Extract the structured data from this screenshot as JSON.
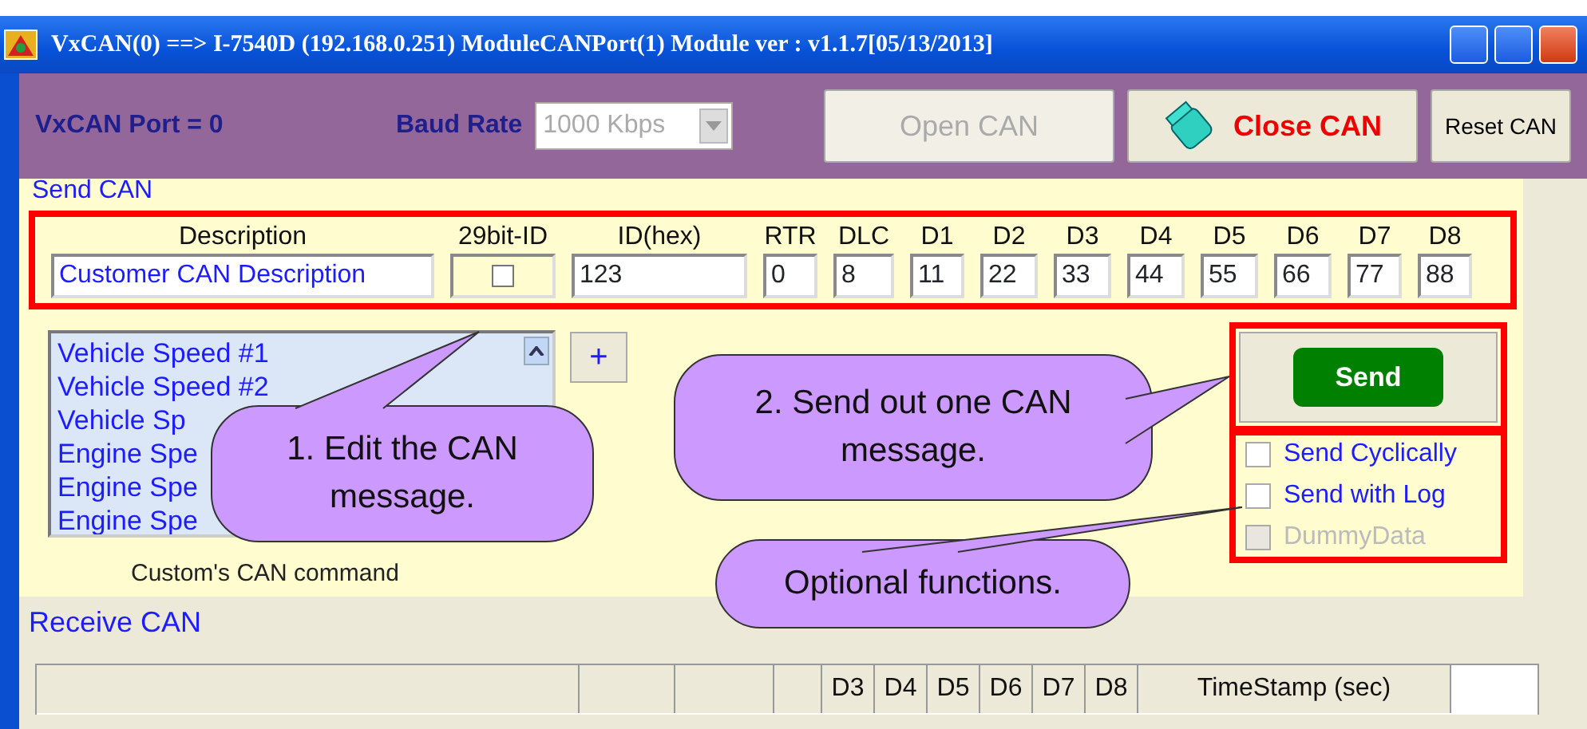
{
  "window": {
    "title": "VxCAN(0) ==> I-7540D (192.168.0.251) ModuleCANPort(1) Module ver : v1.1.7[05/13/2013]"
  },
  "toolbar": {
    "port_label": "VxCAN Port = 0",
    "baud_label": "Baud Rate",
    "baud_value": "1000 Kbps",
    "baud_disabled": true,
    "buttons": [
      {
        "label": "Open CAN",
        "kind": "plain",
        "disabled": true
      },
      {
        "label": "Close CAN",
        "kind": "icon",
        "disabled": false
      },
      {
        "label": "Reset CAN",
        "kind": "small",
        "disabled": false
      }
    ]
  },
  "send_can": {
    "title": "Send CAN",
    "fields": [
      {
        "label": "Description",
        "kind": "text",
        "value": "Customer CAN Description"
      },
      {
        "label": "29bit-ID",
        "kind": "checkbox",
        "checked": false
      },
      {
        "label": "ID(hex)",
        "kind": "text",
        "value": "123"
      },
      {
        "label": "RTR",
        "kind": "text",
        "value": "0"
      },
      {
        "label": "DLC",
        "kind": "text",
        "value": "8"
      },
      {
        "label": "D1",
        "kind": "text",
        "value": "11"
      },
      {
        "label": "D2",
        "kind": "text",
        "value": "22"
      },
      {
        "label": "D3",
        "kind": "text",
        "value": "33"
      },
      {
        "label": "D4",
        "kind": "text",
        "value": "44"
      },
      {
        "label": "D5",
        "kind": "text",
        "value": "55"
      },
      {
        "label": "D6",
        "kind": "text",
        "value": "66"
      },
      {
        "label": "D7",
        "kind": "text",
        "value": "77"
      },
      {
        "label": "D8",
        "kind": "text",
        "value": "88"
      }
    ],
    "commands": [
      "Vehicle Speed #1",
      "Vehicle Speed #2",
      "Vehicle Sp",
      "Engine Spe",
      "Engine Spe",
      "Engine Spe"
    ],
    "add_button": "+",
    "commands_caption": "Custom's CAN command",
    "send_button": "Send",
    "options": [
      {
        "label": "Send Cyclically",
        "checked": false,
        "disabled": false
      },
      {
        "label": "Send with Log",
        "checked": false,
        "disabled": false
      },
      {
        "label": "DummyData",
        "checked": false,
        "disabled": true
      }
    ]
  },
  "receive_can": {
    "title": "Receive CAN",
    "columns": [
      "D3",
      "D4",
      "D5",
      "D6",
      "D7",
      "D8",
      "TimeStamp (sec)"
    ]
  },
  "callouts": [
    {
      "text": "1. Edit the CAN message."
    },
    {
      "text": "2. Send out one CAN message."
    },
    {
      "text": "Optional functions."
    }
  ]
}
